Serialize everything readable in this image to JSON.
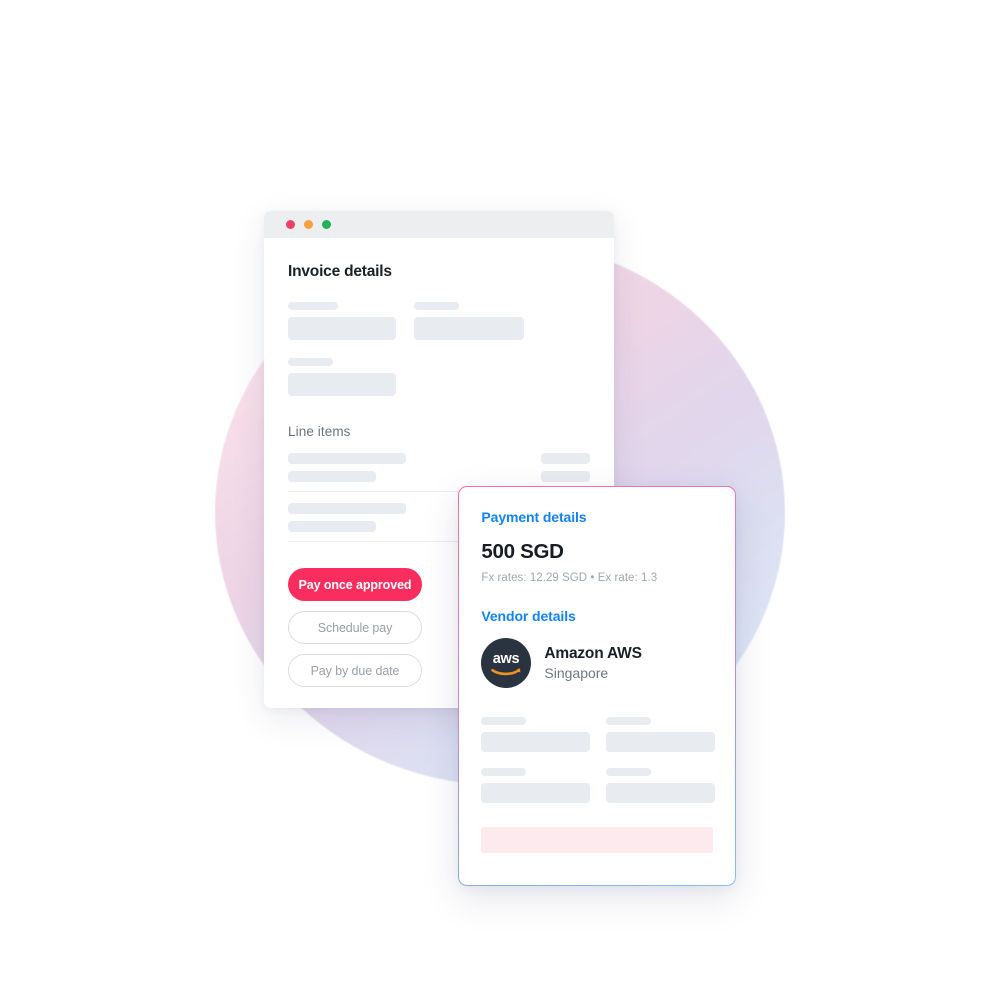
{
  "window": {
    "traffic_lights": [
      {
        "name": "close",
        "color": "#ee3f66"
      },
      {
        "name": "minimize",
        "color": "#f7a03c"
      },
      {
        "name": "maximize",
        "color": "#23b05a"
      }
    ],
    "invoice_title": "Invoice details",
    "line_items_title": "Line items"
  },
  "actions": {
    "primary_label": "Pay once approved",
    "schedule_label": "Schedule pay",
    "due_date_label": "Pay by due date"
  },
  "payment_card": {
    "payment_heading": "Payment details",
    "amount": "500 SGD",
    "fx_line": "Fx rates: 12.29 SGD • Ex rate: 1.3",
    "vendor_heading": "Vendor details",
    "vendor": {
      "logo_text": "aws",
      "name": "Amazon AWS",
      "location": "Singapore"
    }
  },
  "colors": {
    "accent_pink": "#fa2e5e",
    "accent_blue": "#1283f2",
    "skeleton": "#e8ebf0",
    "pink_highlight": "#fdeaef",
    "aws_navy": "#2a3441",
    "aws_orange": "#f0921f",
    "titlebar": "#eceef0"
  }
}
